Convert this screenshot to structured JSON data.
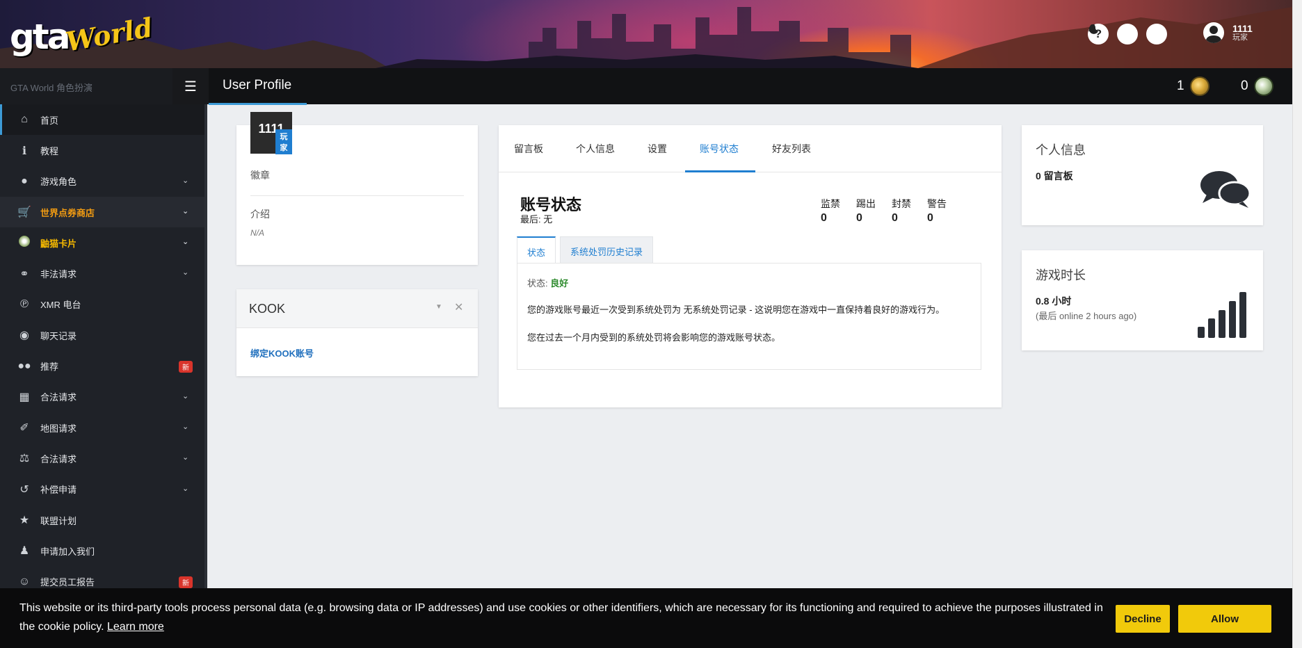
{
  "header": {
    "logo_gta": "gta",
    "logo_world": "World",
    "user_name": "1111",
    "user_role": "玩家",
    "help_icon": "question-icon",
    "theme_icon": "moon-icon",
    "notify_icon": "bell-icon"
  },
  "topbar": {
    "brand": "GTA World 角色扮演",
    "page_title": "User Profile",
    "gold_count": "1",
    "green_count": "0"
  },
  "sidebar": {
    "items": [
      {
        "label": "首页",
        "icon": "home-icon"
      },
      {
        "label": "教程",
        "icon": "info-icon"
      },
      {
        "label": "游戏角色",
        "icon": "user-icon"
      },
      {
        "label": "世界点券商店",
        "icon": "cart-icon"
      },
      {
        "label": "鼬猫卡片",
        "icon": "card-icon"
      },
      {
        "label": "非法请求",
        "icon": "mask-icon"
      },
      {
        "label": "XMR 电台",
        "icon": "radio-icon"
      },
      {
        "label": "聊天记录",
        "icon": "chat-icon"
      },
      {
        "label": "推荐",
        "icon": "users-icon",
        "badge": "新"
      },
      {
        "label": "合法请求",
        "icon": "building-icon"
      },
      {
        "label": "地图请求",
        "icon": "brush-icon"
      },
      {
        "label": "合法请求",
        "icon": "scale-icon"
      },
      {
        "label": "补偿申请",
        "icon": "undo-icon"
      },
      {
        "label": "联盟计划",
        "icon": "star-icon"
      },
      {
        "label": "申请加入我们",
        "icon": "user-tie-icon"
      },
      {
        "label": "提交员工报告",
        "icon": "face-icon",
        "badge": "新"
      }
    ]
  },
  "profile": {
    "name": "1111",
    "role": "玩家",
    "badges_label": "徽章",
    "intro_label": "介绍",
    "intro_value": "N/A"
  },
  "kook": {
    "title": "KOOK",
    "bind_link": "绑定KOOK账号"
  },
  "main": {
    "tabs": [
      "留言板",
      "个人信息",
      "设置",
      "账号状态",
      "好友列表"
    ],
    "active_tab": "账号状态",
    "account_title": "账号状态",
    "last_label": "最后: 无",
    "stats": [
      {
        "label": "监禁",
        "value": "0"
      },
      {
        "label": "踢出",
        "value": "0"
      },
      {
        "label": "封禁",
        "value": "0"
      },
      {
        "label": "警告",
        "value": "0"
      }
    ],
    "subtabs": [
      "状态",
      "系统处罚历史记录"
    ],
    "status_prefix": "状态:",
    "status_value": "良好",
    "status_p1": "您的游戏账号最近一次受到系统处罚为 无系统处罚记录 - 这说明您在游戏中一直保持着良好的游戏行为。",
    "status_p2": "您在过去一个月内受到的系统处罚将会影响您的游戏账号状态。"
  },
  "info_card": {
    "title": "个人信息",
    "value": "0 留言板"
  },
  "time_card": {
    "title": "游戏时长",
    "value": "0.8 小时",
    "sub": "(最后 online 2 hours ago)"
  },
  "cookie": {
    "text": "This website or its third-party tools process personal data (e.g. browsing data or IP addresses) and use cookies or other identifiers, which are necessary for its functioning and required to achieve the purposes illustrated in the cookie policy.",
    "learn_more": "Learn more",
    "decline": "Decline",
    "allow": "Allow"
  },
  "colors": {
    "accent": "#1f7ed0",
    "cookie_button": "#f1ca0b",
    "badge_new": "#d9342b",
    "status_good": "#2e8b2e"
  }
}
